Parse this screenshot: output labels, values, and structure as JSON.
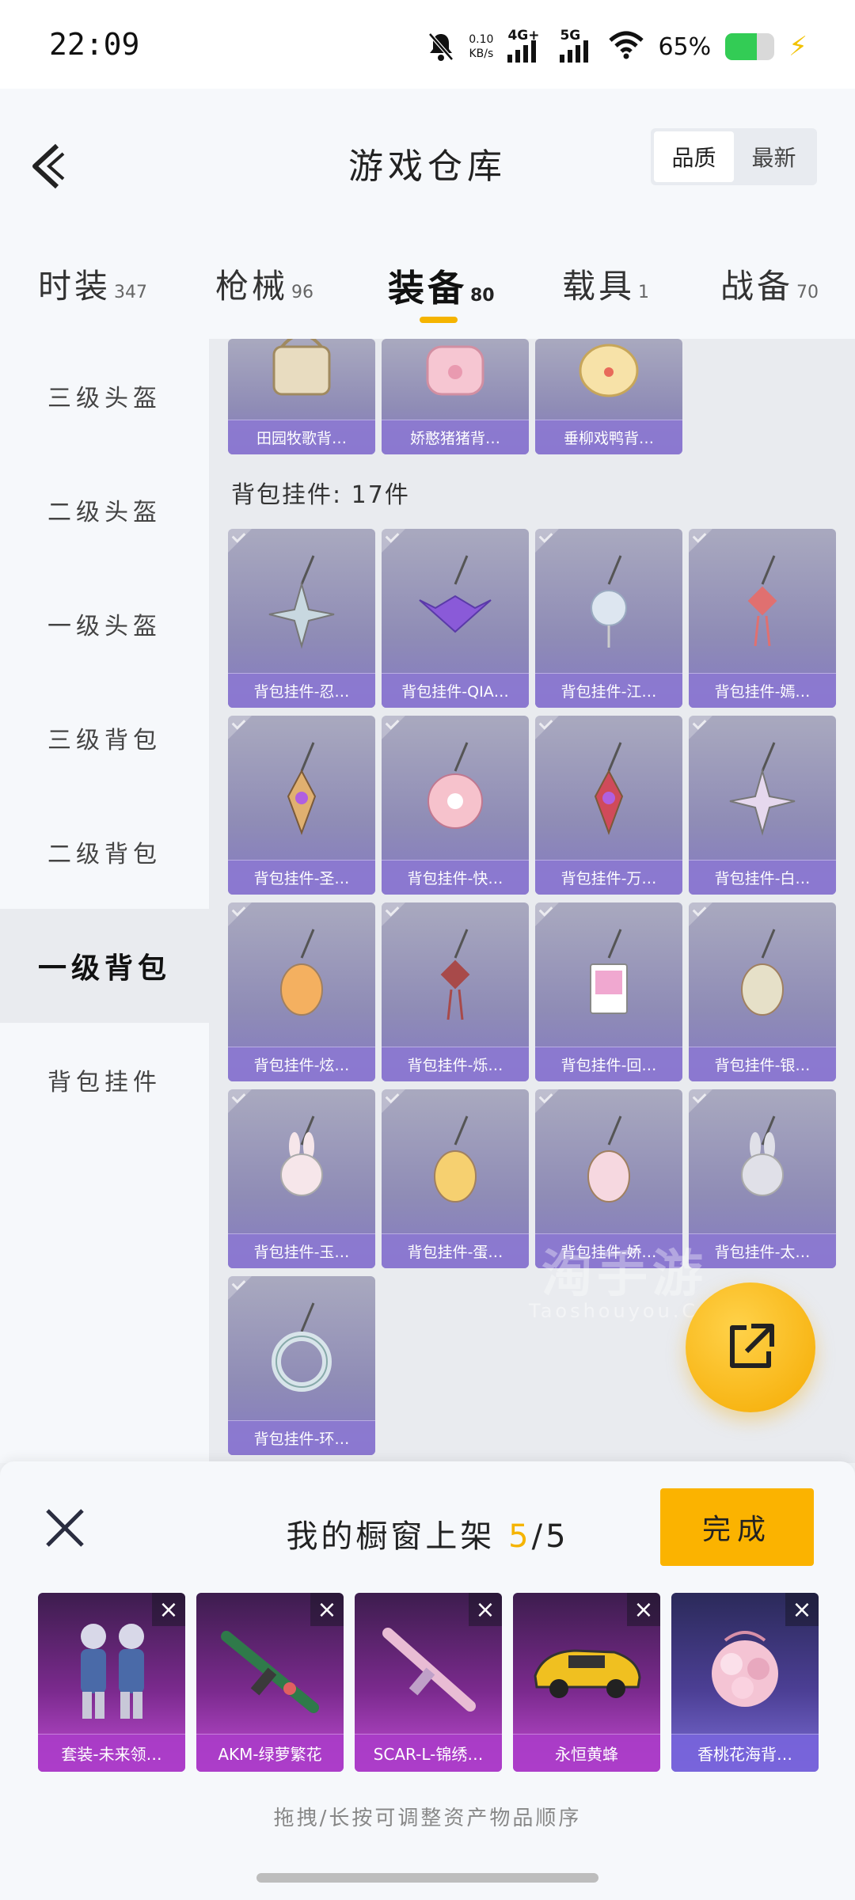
{
  "status_bar": {
    "time": "22:09",
    "net_speed_value": "0.10",
    "net_speed_unit": "KB/s",
    "signal1_label": "4G+",
    "signal2_label": "5G",
    "battery_pct": "65%",
    "battery_level": 0.65
  },
  "header": {
    "title": "游戏仓库",
    "sort_options": [
      "品质",
      "最新"
    ],
    "sort_active": "品质"
  },
  "tabs": [
    {
      "name": "时装",
      "count": "347"
    },
    {
      "name": "枪械",
      "count": "96"
    },
    {
      "name": "装备",
      "count": "80",
      "active": true
    },
    {
      "name": "载具",
      "count": "1"
    },
    {
      "name": "战备",
      "count": "70"
    }
  ],
  "sidebar": {
    "items": [
      "三级头盔",
      "二级头盔",
      "一级头盔",
      "三级背包",
      "二级背包",
      "一级背包",
      "背包挂件"
    ],
    "active": "一级背包"
  },
  "content": {
    "top_row_labels": [
      "田园牧歌背…",
      "娇憨猪猪背…",
      "垂柳戏鸭背…"
    ],
    "section_label": "背包挂件: 17件",
    "items": [
      "背包挂件-忍…",
      "背包挂件-QIA…",
      "背包挂件-江…",
      "背包挂件-嫣…",
      "背包挂件-圣…",
      "背包挂件-快…",
      "背包挂件-万…",
      "背包挂件-白…",
      "背包挂件-炫…",
      "背包挂件-烁…",
      "背包挂件-回…",
      "背包挂件-银…",
      "背包挂件-玉…",
      "背包挂件-蛋…",
      "背包挂件-娇…",
      "背包挂件-太…",
      "背包挂件-环…"
    ],
    "watermark": "淘手游",
    "watermark_sub": "Taoshouyou.Com"
  },
  "bottom_panel": {
    "title_prefix": "我的橱窗上架",
    "count_current": "5",
    "count_sep": "/5",
    "done_label": "完成",
    "close_symbol": "×",
    "shelf_items": [
      "套装-未来领…",
      "AKM-绿萝繁花",
      "SCAR-L-锦绣…",
      "永恒黄蜂",
      "香桃花海背…"
    ],
    "hint": "拖拽/长按可调整资产物品顺序"
  },
  "colors": {
    "accent": "#f5b400",
    "card_purple": "#8479c2",
    "shelf_purple": "#c24ed6"
  }
}
